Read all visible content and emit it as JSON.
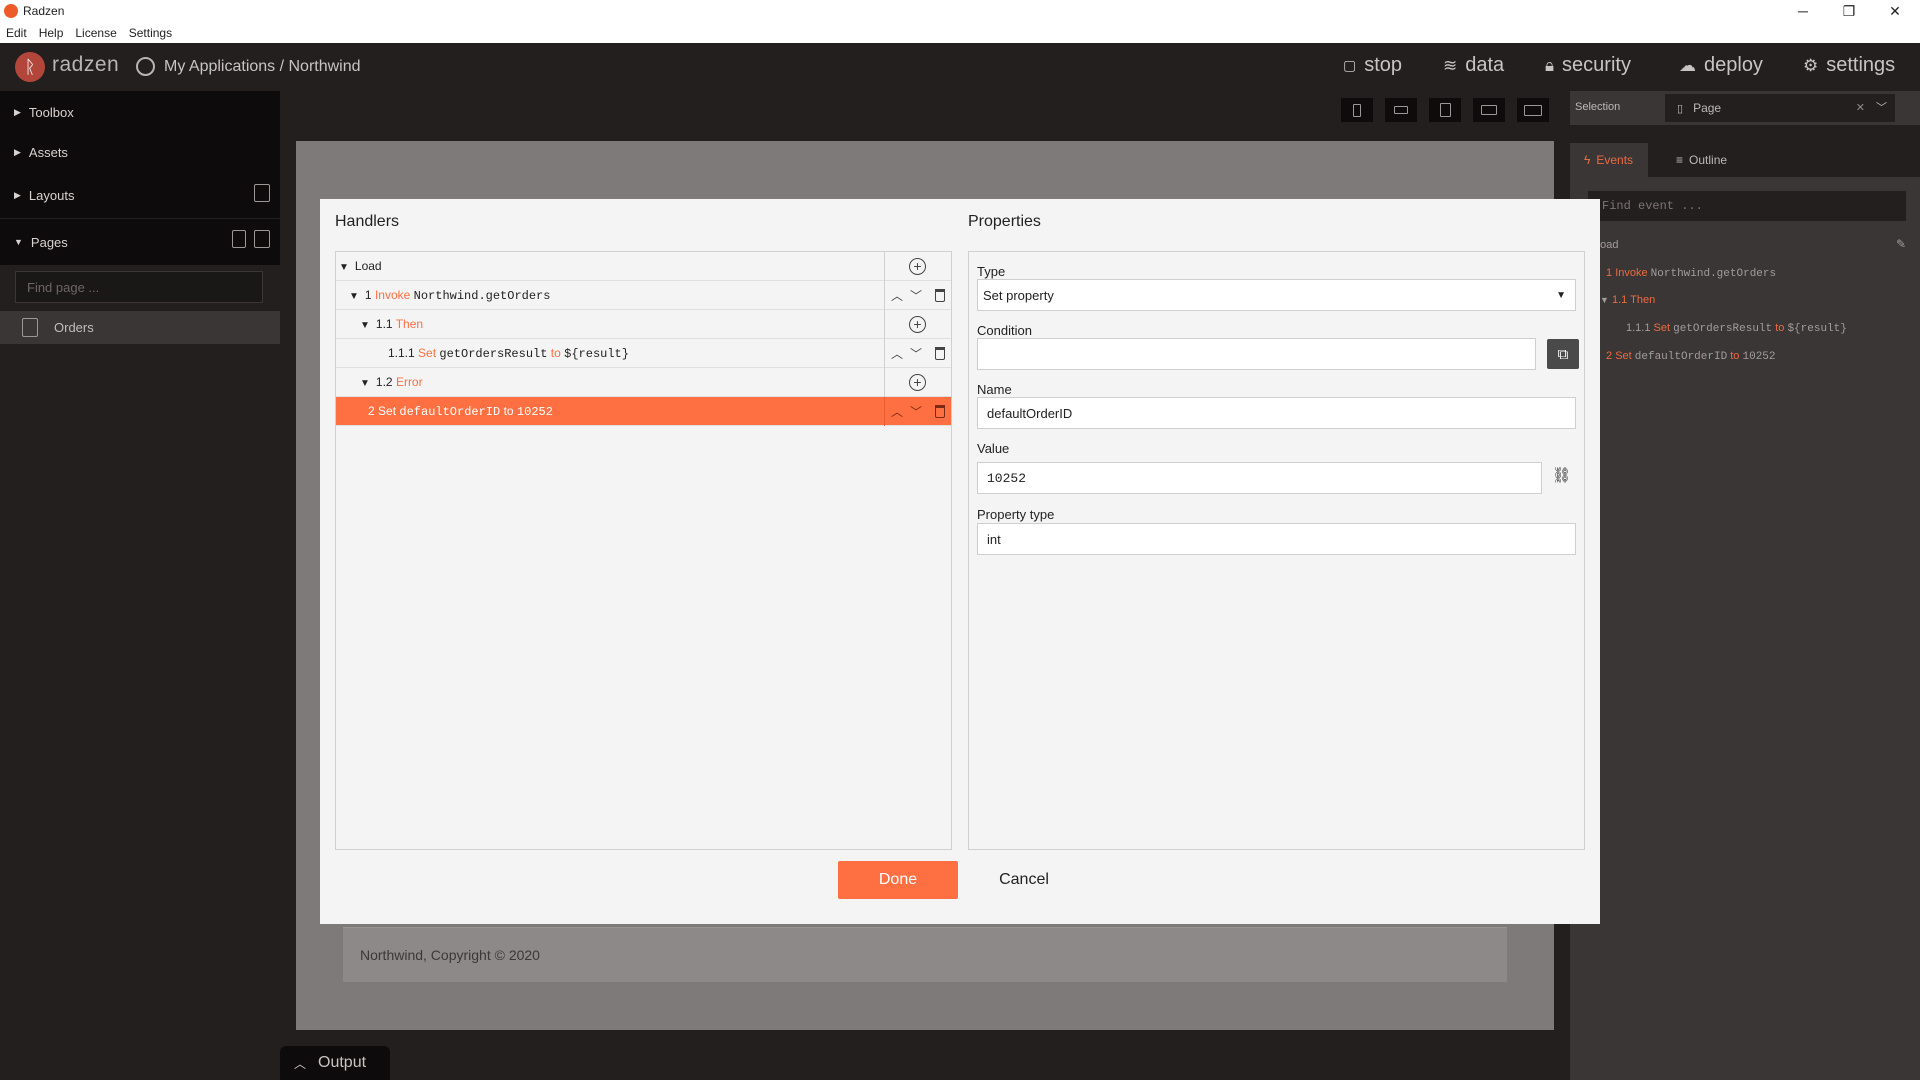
{
  "window": {
    "title": "Radzen",
    "menu": [
      "Edit",
      "Help",
      "License",
      "Settings"
    ],
    "controls": {
      "minimize": "─",
      "restore": "❐",
      "close": "✕"
    }
  },
  "header": {
    "brand": "radzen",
    "breadcrumb": "My Applications / Northwind",
    "nav": [
      {
        "label": "stop",
        "icon": "stop-icon"
      },
      {
        "label": "data",
        "icon": "layers-icon"
      },
      {
        "label": "security",
        "icon": "lock-icon"
      },
      {
        "label": "deploy",
        "icon": "cloud-upload-icon"
      },
      {
        "label": "settings",
        "icon": "gear-icon"
      }
    ]
  },
  "sidebar": {
    "sections": [
      "Toolbox",
      "Assets",
      "Layouts",
      "Pages"
    ],
    "find_placeholder": "Find page ...",
    "pages": [
      "Orders"
    ]
  },
  "canvas": {
    "footer_text": "Northwind, Copyright © 2020",
    "output_tab": "Output"
  },
  "right_panel": {
    "selection_label": "Selection",
    "selection_value": "Page",
    "tabs": [
      "Events",
      "Outline"
    ],
    "find_placeholder": "Find event ...",
    "event_name": "Load",
    "items": [
      {
        "num": "1",
        "kw": "Invoke",
        "text": "Northwind.getOrders"
      },
      {
        "num": "1.1",
        "kw": "Then",
        "text": ""
      },
      {
        "num": "1.1.1",
        "kw": "Set",
        "text": "getOrdersResult",
        "to": "to",
        "value": "${result}"
      },
      {
        "num": "2",
        "kw": "Set",
        "text": "defaultOrderID",
        "to": "to",
        "value": "10252"
      }
    ]
  },
  "modal": {
    "handlers_title": "Handlers",
    "properties_title": "Properties",
    "rows": [
      {
        "num": "",
        "kw": "Load",
        "text": "",
        "to": "",
        "value": ""
      },
      {
        "num": "1",
        "kw": "Invoke",
        "text": "Northwind.getOrders",
        "to": "",
        "value": ""
      },
      {
        "num": "1.1",
        "kw": "Then",
        "text": "",
        "to": "",
        "value": ""
      },
      {
        "num": "1.1.1",
        "kw": "Set",
        "text": "getOrdersResult",
        "to": "to",
        "value": "${result}"
      },
      {
        "num": "1.2",
        "kw": "Error",
        "text": "",
        "to": "",
        "value": ""
      },
      {
        "num": "2",
        "kw": "Set",
        "text": "defaultOrderID",
        "to": "to",
        "value": "10252"
      }
    ],
    "fields": {
      "type_label": "Type",
      "type_value": "Set property",
      "condition_label": "Condition",
      "condition_value": "",
      "name_label": "Name",
      "name_value": "defaultOrderID",
      "value_label": "Value",
      "value_value": "10252",
      "property_type_label": "Property type",
      "property_type_value": "int"
    },
    "done_label": "Done",
    "cancel_label": "Cancel"
  },
  "colors": {
    "accent": "#fe6f41",
    "app_background": "#231f1f"
  }
}
